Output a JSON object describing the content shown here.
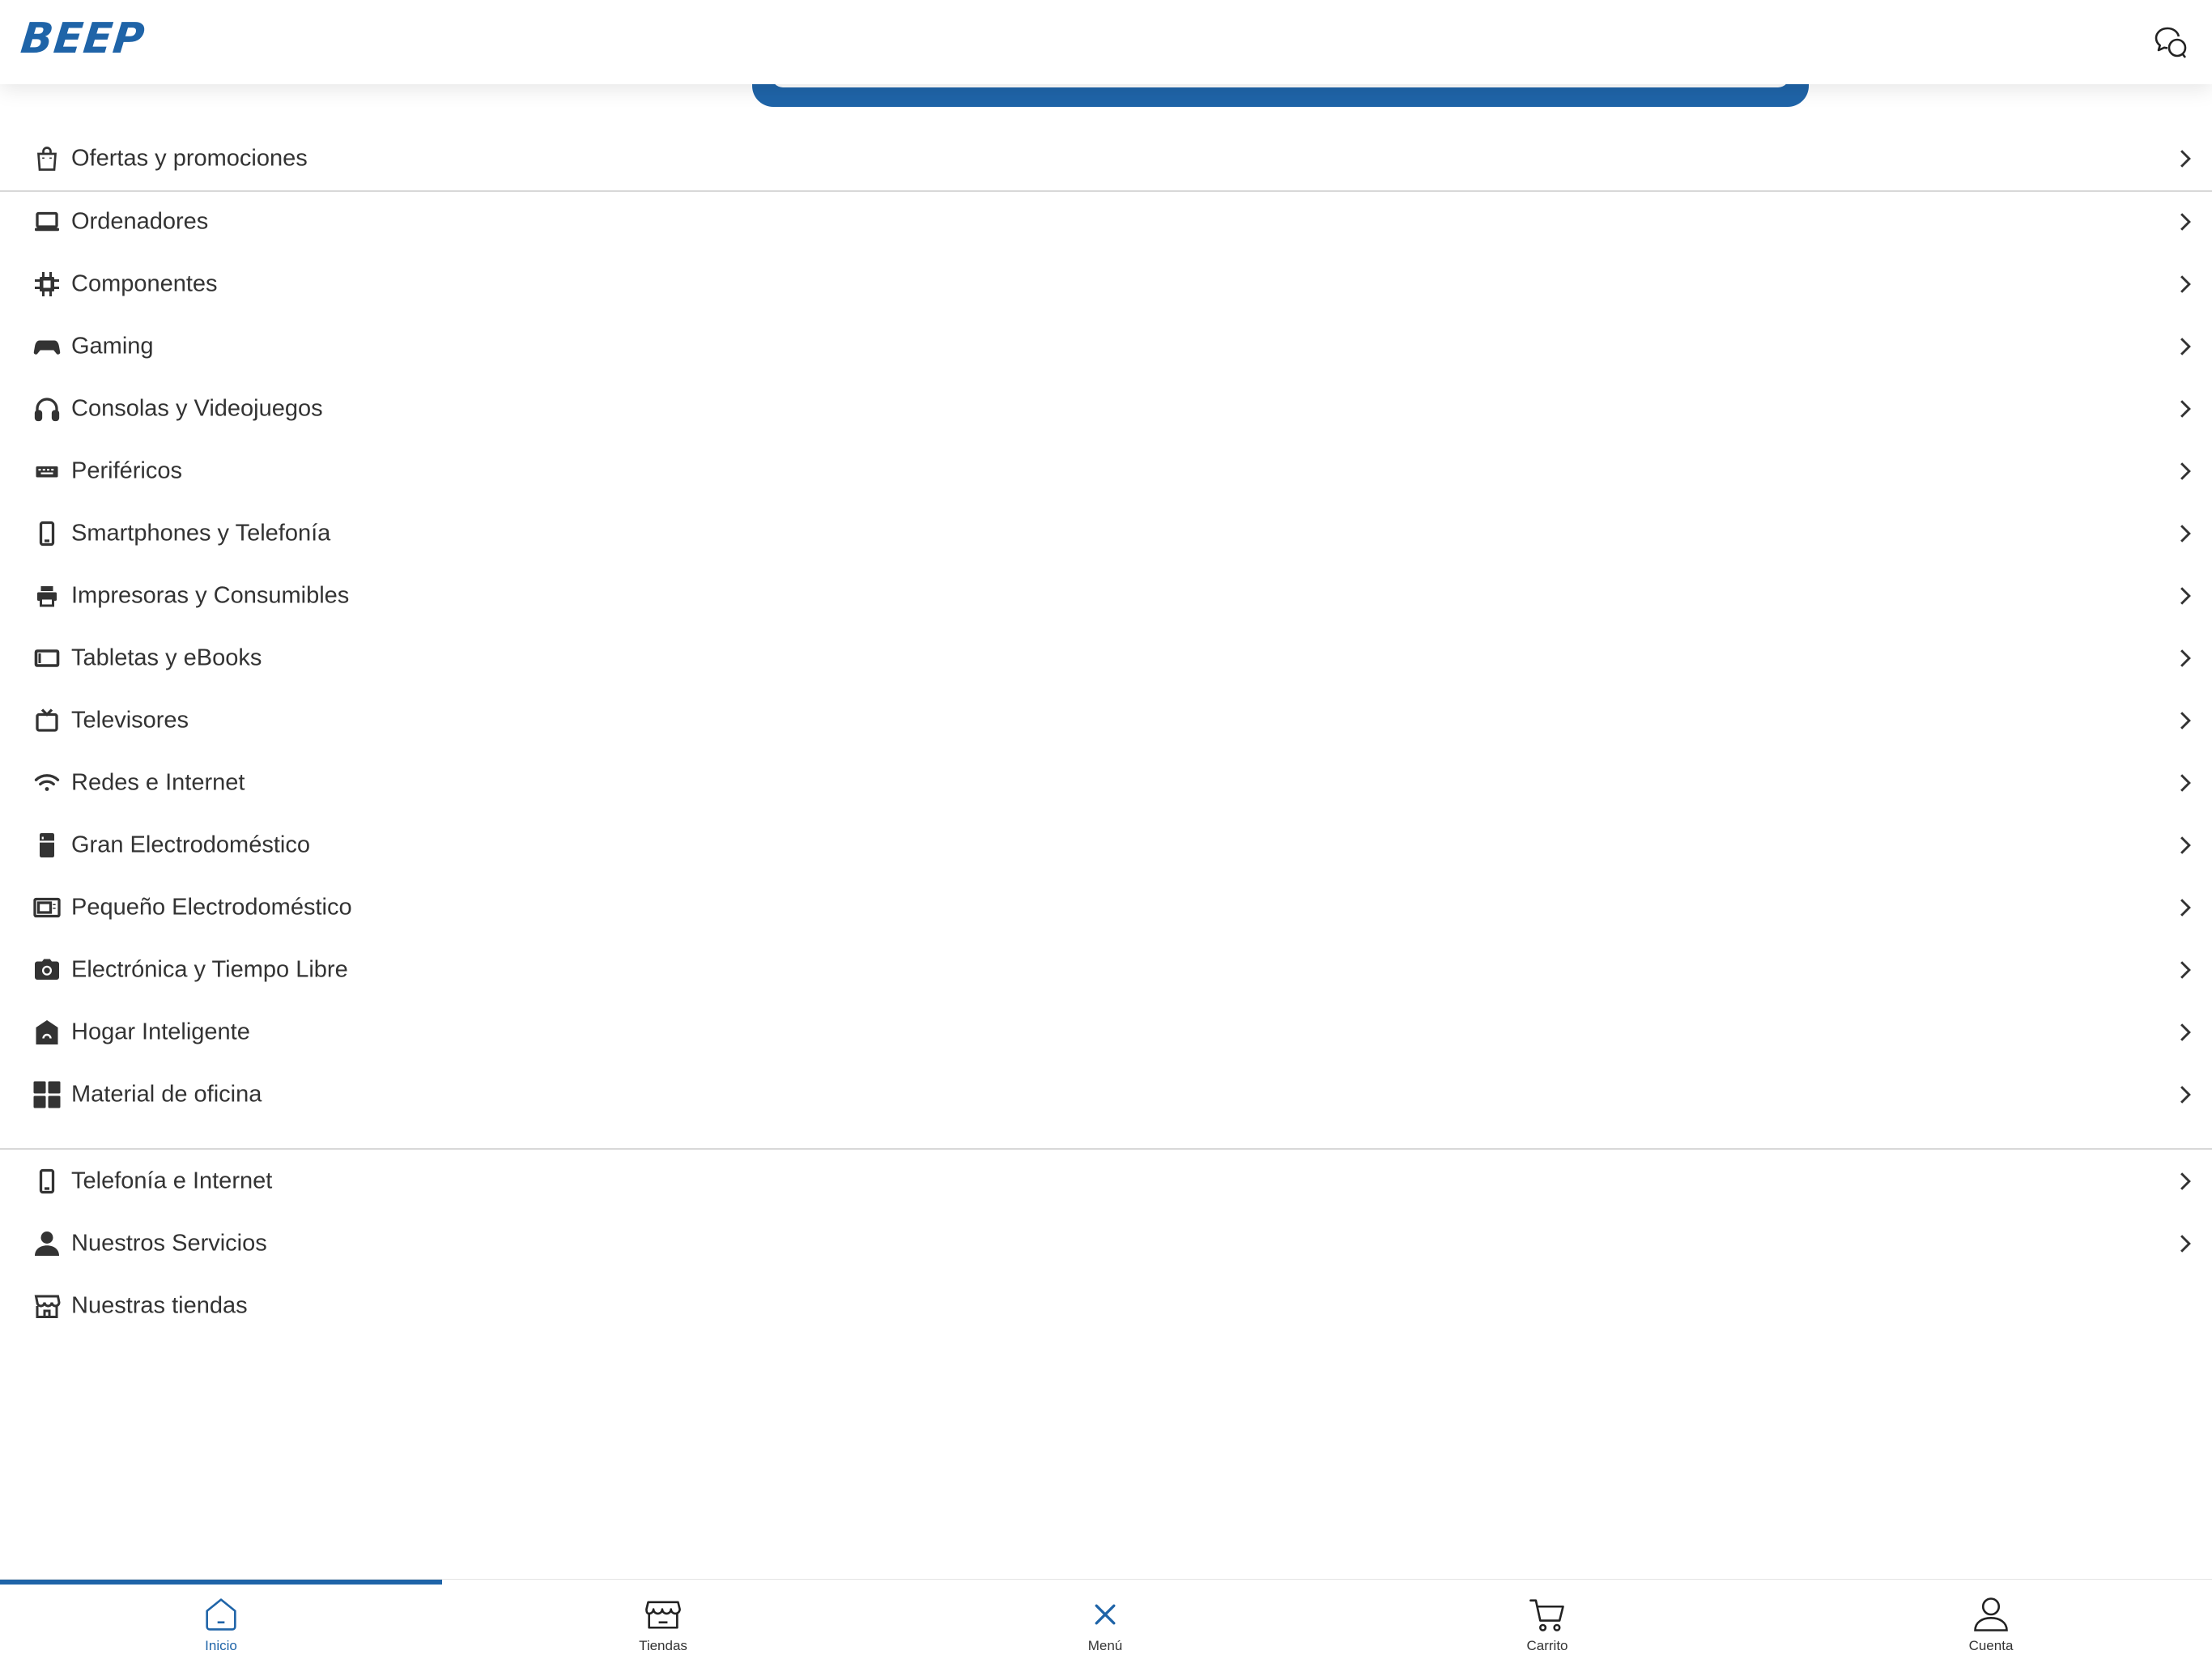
{
  "header": {
    "logo": "BEEP",
    "chat_icon": "chat-bubbles-icon"
  },
  "colors": {
    "brand": "#1f64a8",
    "text": "#333333",
    "divider": "#d8d8d8"
  },
  "menu": {
    "promo": {
      "label": "Ofertas y promociones",
      "icon": "shopping-bag-icon"
    },
    "categories": [
      {
        "label": "Ordenadores",
        "icon": "laptop-icon"
      },
      {
        "label": "Componentes",
        "icon": "chip-icon"
      },
      {
        "label": "Gaming",
        "icon": "gamepad-icon"
      },
      {
        "label": "Consolas y Videojuegos",
        "icon": "headset-icon"
      },
      {
        "label": "Periféricos",
        "icon": "keyboard-icon"
      },
      {
        "label": "Smartphones y Telefonía",
        "icon": "smartphone-icon"
      },
      {
        "label": "Impresoras y Consumibles",
        "icon": "printer-icon"
      },
      {
        "label": "Tabletas y eBooks",
        "icon": "tablet-icon"
      },
      {
        "label": "Televisores",
        "icon": "tv-icon"
      },
      {
        "label": "Redes e Internet",
        "icon": "wifi-icon"
      },
      {
        "label": "Gran Electrodoméstico",
        "icon": "fridge-icon"
      },
      {
        "label": "Pequeño Electrodoméstico",
        "icon": "microwave-icon"
      },
      {
        "label": "Electrónica y Tiempo Libre",
        "icon": "camera-icon"
      },
      {
        "label": "Hogar Inteligente",
        "icon": "smart-home-icon"
      },
      {
        "label": "Material de oficina",
        "icon": "grid-icon"
      }
    ],
    "extra": [
      {
        "label": "Telefonía e Internet",
        "icon": "smartphone-icon"
      },
      {
        "label": "Nuestros Servicios",
        "icon": "person-icon"
      },
      {
        "label": "Nuestras tiendas",
        "icon": "store-icon"
      }
    ]
  },
  "bottom_nav": {
    "tabs": [
      {
        "label": "Inicio",
        "icon": "home-icon",
        "active": true
      },
      {
        "label": "Tiendas",
        "icon": "store-icon"
      },
      {
        "label": "Menú",
        "icon": "close-icon"
      },
      {
        "label": "Carrito",
        "icon": "cart-icon"
      },
      {
        "label": "Cuenta",
        "icon": "user-icon"
      }
    ]
  }
}
